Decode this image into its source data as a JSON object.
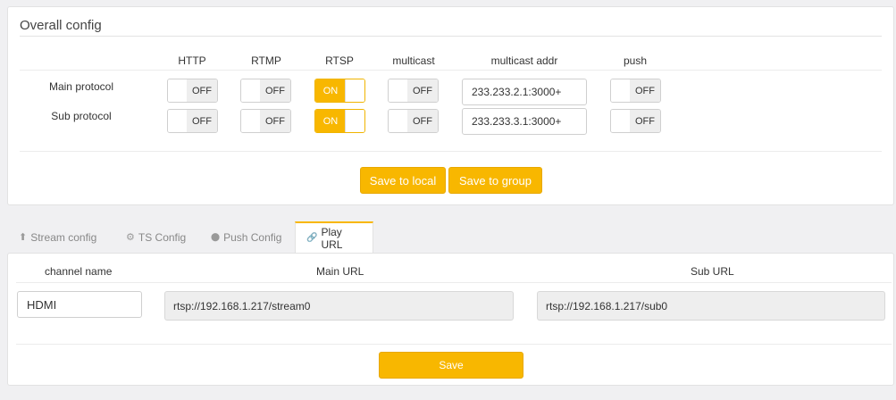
{
  "overall": {
    "title": "Overall config",
    "headers": [
      "HTTP",
      "RTMP",
      "RTSP",
      "multicast",
      "multicast addr",
      "push"
    ],
    "rows": [
      {
        "label": "Main protocol",
        "http": "OFF",
        "rtmp": "OFF",
        "rtsp": "ON",
        "multicast": "OFF",
        "multicast_addr": "233.233.2.1:3000+",
        "push": "OFF"
      },
      {
        "label": "Sub protocol",
        "http": "OFF",
        "rtmp": "OFF",
        "rtsp": "ON",
        "multicast": "OFF",
        "multicast_addr": "233.233.3.1:3000+",
        "push": "OFF"
      }
    ],
    "save_local_label": "Save to local",
    "save_group_label": "Save to group"
  },
  "tabs": [
    {
      "label": "Stream config",
      "icon": "upload-icon",
      "glyph": "⬆",
      "active": false
    },
    {
      "label": "TS Config",
      "icon": "gear-icon",
      "glyph": "⚙",
      "active": false
    },
    {
      "label": "Push Config",
      "icon": "push-icon",
      "glyph": "⬤",
      "active": false
    },
    {
      "label": "Play URL",
      "icon": "link-icon",
      "glyph": "🔗",
      "active": true
    }
  ],
  "play": {
    "headers": {
      "channel": "channel name",
      "main": "Main URL",
      "sub": "Sub URL"
    },
    "channel_name": "HDMI",
    "main_url": "rtsp://192.168.1.217/stream0",
    "sub_url": "rtsp://192.168.1.217/sub0",
    "save_label": "Save"
  },
  "colors": {
    "accent": "#f8b700",
    "panel_bg": "#ffffff",
    "page_bg": "#f0f0f2"
  }
}
